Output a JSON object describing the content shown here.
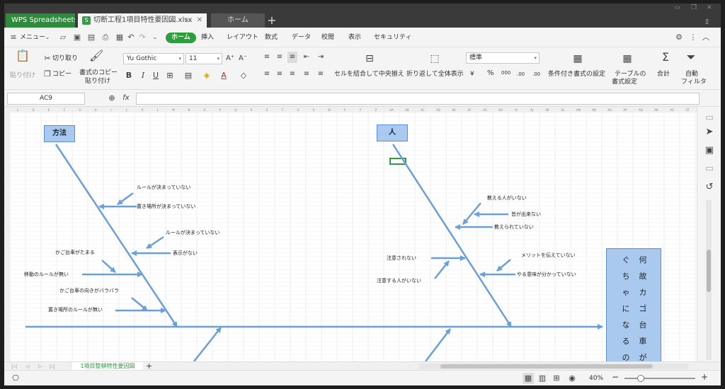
{
  "tabs": {
    "app": "WPS Spreadsheets",
    "file": "切断工程1項目特性要因図.xlsx",
    "home": "ホーム",
    "new": "+"
  },
  "menu": {
    "menu_label": "メニュー",
    "items": [
      "ホーム",
      "挿入",
      "レイアウト",
      "数式",
      "データ",
      "校閲",
      "表示",
      "セキュリティ"
    ]
  },
  "ribbon": {
    "paste": "貼り付け",
    "cut": "切り取り",
    "copy": "コピー",
    "format_copy": "書式のコピー",
    "format_paste": "貼り付け",
    "font": "Yu Gothic",
    "size": "11",
    "merge": "セルを結合して中央揃え",
    "wrap": "折り返して全体表示",
    "number_format": "標準",
    "currency": "¥",
    "percent": "%",
    "thousands": "000",
    "dec_up": ".00",
    "dec_down": ".00",
    "conditional": "条件付き書式の設定",
    "table_l1": "テーブルの",
    "table_l2": "書式設定",
    "sum": "合計",
    "filter": "自動",
    "filter2": "フィルタ",
    "bold": "B",
    "italic": "I",
    "underline": "U",
    "fontcolor": "A",
    "grow": "A⁺",
    "shrink": "A⁻"
  },
  "formula": {
    "cell": "AC9",
    "fx": "fx"
  },
  "sheet": {
    "box_method": "方法",
    "box_person": "人",
    "labels": {
      "m1": "ルールが決まっていない",
      "m2": "置き場所が決まっていない",
      "m3": "ルールが決まっていない",
      "m4": "表示がない",
      "m5": "かご台車がたまる",
      "m6": "移動のルールが無い",
      "m7": "かご台車の向きがバラバラ",
      "m8": "置き場所のルールが無い",
      "p1": "教える人がいない",
      "p2": "皆が出来ない",
      "p3": "教えられていない",
      "p4": "メリットを伝えていない",
      "p5": "注意されない",
      "p6": "やる意味が分かっていない",
      "p7": "注意する人がいない"
    },
    "question": [
      "何故カゴ台車が",
      "ぐちゃになるの"
    ]
  },
  "sheet_tab": "1項目整頓特性要因図",
  "zoom": "40%",
  "col_letters": [
    "C",
    "D",
    "E",
    "F",
    "G",
    "H",
    "I",
    "J",
    "K",
    "L",
    "M",
    "N",
    "O",
    "P",
    "Q",
    "R",
    "S",
    "T",
    "U",
    "V",
    "W",
    "X",
    "Y",
    "Z",
    "AA",
    "AB",
    "AC",
    "AD",
    "AE",
    "AF",
    "AG",
    "AH",
    "AI",
    "AJ",
    "AK",
    "AL",
    "AM",
    "AN",
    "AO",
    "AP",
    "AQ",
    "AR",
    "AS",
    "AT",
    "AU"
  ],
  "colors": {
    "accent": "#2e9d3e",
    "arrow": "#6a9fd8",
    "box": "#a9c9ef"
  }
}
